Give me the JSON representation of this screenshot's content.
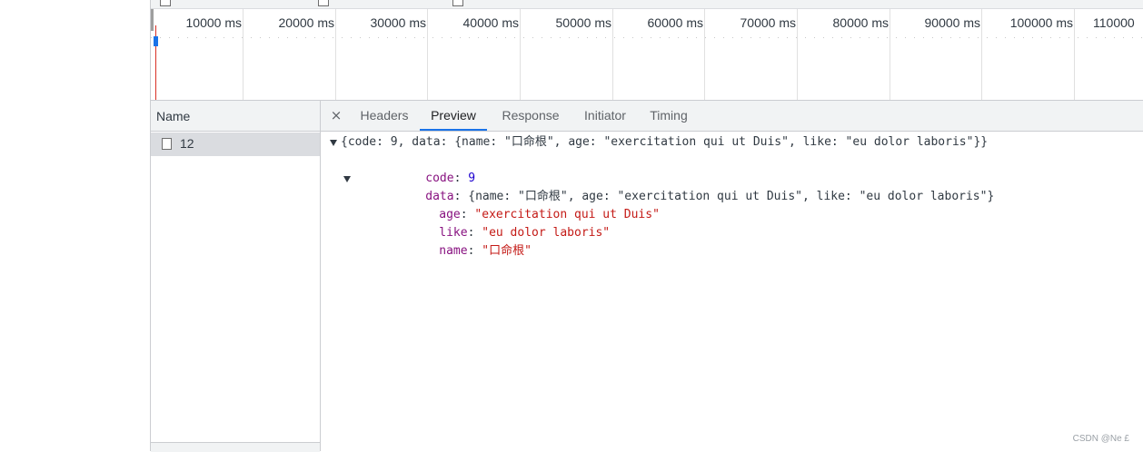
{
  "timeline": {
    "ticks": [
      "10000 ms",
      "20000 ms",
      "30000 ms",
      "40000 ms",
      "50000 ms",
      "60000 ms",
      "70000 ms",
      "80000 ms",
      "90000 ms",
      "100000 ms",
      "110000"
    ]
  },
  "name_panel": {
    "header": "Name",
    "rows": [
      {
        "label": "12"
      }
    ]
  },
  "tabs": {
    "close": "×",
    "items": [
      "Headers",
      "Preview",
      "Response",
      "Initiator",
      "Timing"
    ],
    "active": "Preview"
  },
  "preview": {
    "summary": "{code: 9, data: {name: \"口命根\", age: \"exercitation qui ut Duis\", like: \"eu dolor laboris\"}}",
    "code_key": "code",
    "code_value": "9",
    "data_key": "data",
    "data_summary": "{name: \"口命根\", age: \"exercitation qui ut Duis\", like: \"eu dolor laboris\"}",
    "fields": [
      {
        "key": "age",
        "value": "\"exercitation qui ut Duis\""
      },
      {
        "key": "like",
        "value": "\"eu dolor laboris\""
      },
      {
        "key": "name",
        "value": "\"口命根\""
      }
    ]
  },
  "watermark": "CSDN @Ne £"
}
